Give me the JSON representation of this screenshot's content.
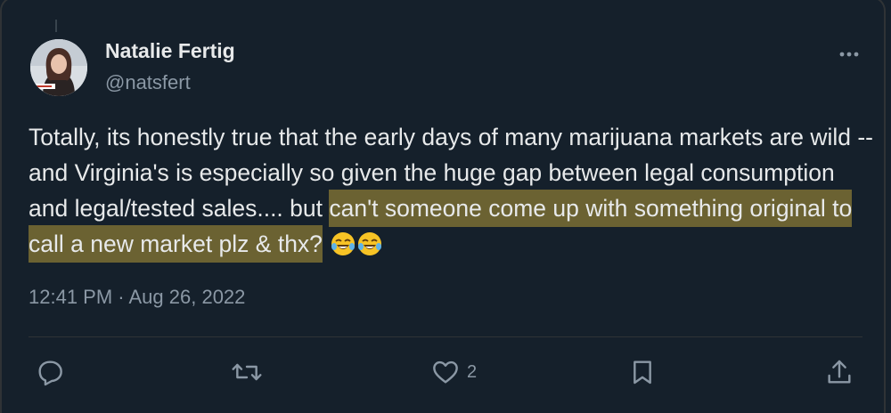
{
  "author": {
    "name": "Natalie Fertig",
    "handle": "@natsfert"
  },
  "tweet": {
    "text_plain": "Totally, its honestly true that the early days of many marijuana markets are wild -- and Virginia's is especially so given the huge gap between legal consumption and legal/tested sales.... but ",
    "text_highlighted": "can't someone come up with something original to call a new market plz & thx?",
    "emojis": [
      "face-with-tears-of-joy",
      "face-with-tears-of-joy"
    ],
    "timestamp": "12:41 PM · Aug 26, 2022"
  },
  "actions": {
    "reply": {
      "icon": "reply-icon"
    },
    "retweet": {
      "icon": "retweet-icon"
    },
    "like": {
      "icon": "heart-icon",
      "count": "2"
    },
    "bookmark": {
      "icon": "bookmark-icon"
    },
    "share": {
      "icon": "share-icon"
    }
  },
  "colors": {
    "background": "#15202b",
    "text": "#e7e9ea",
    "muted": "#8b98a5",
    "highlight": "#6b6232"
  }
}
